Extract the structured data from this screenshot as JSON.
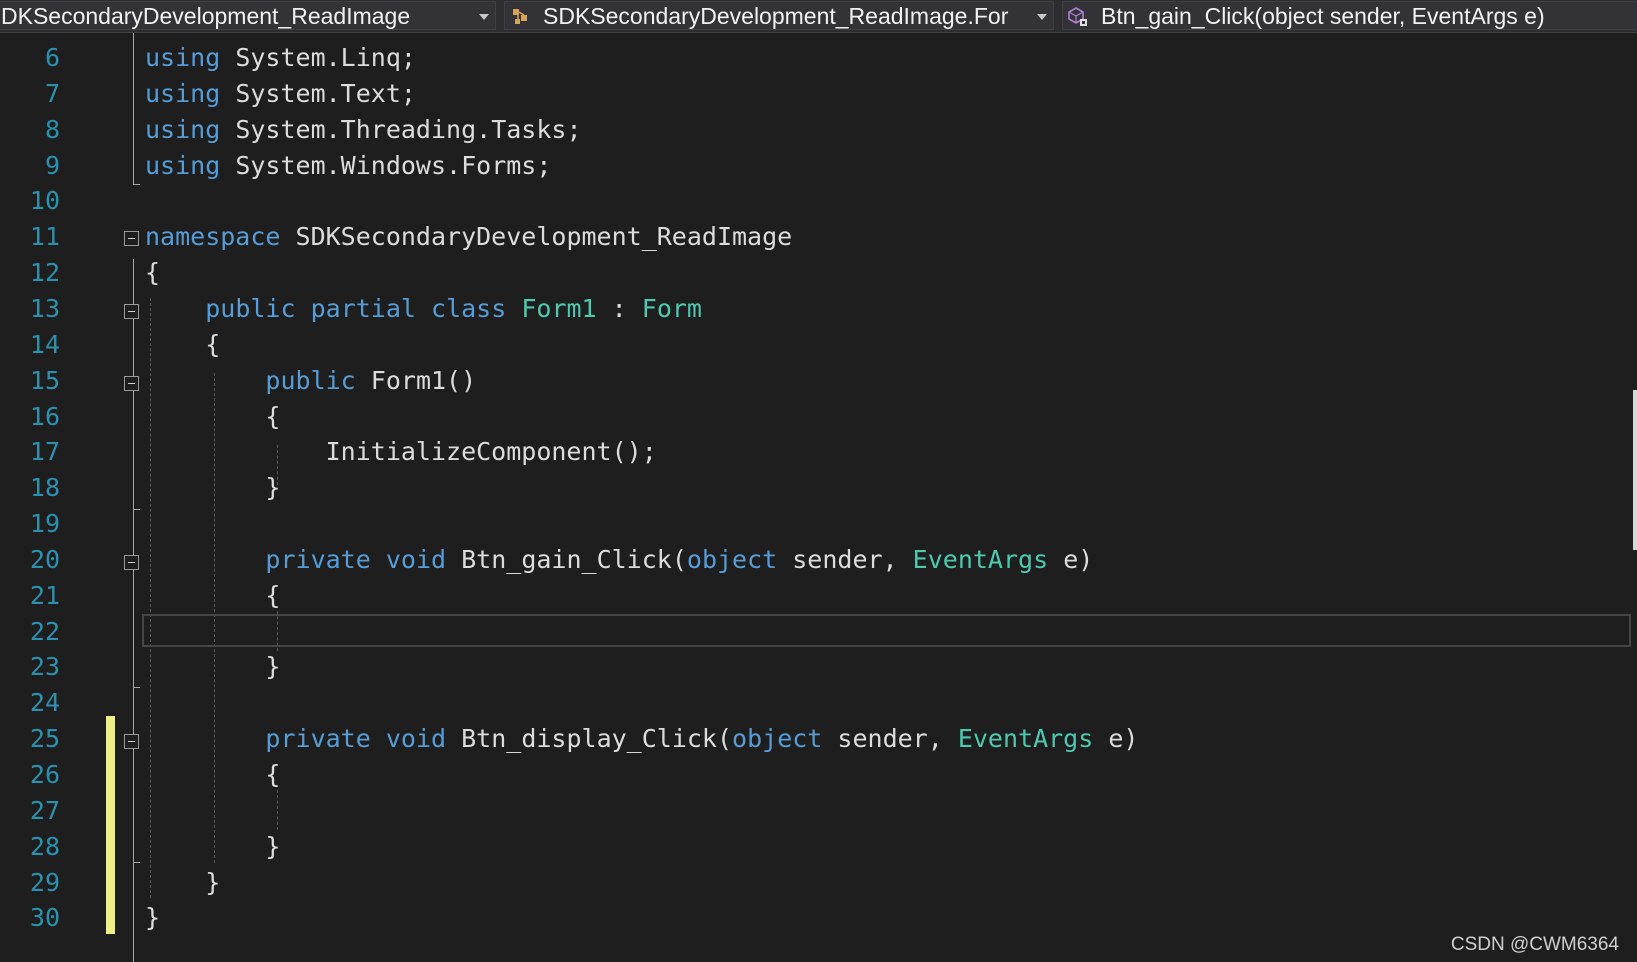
{
  "navigation_bar": {
    "project_dropdown": {
      "label": "DKSecondaryDevelopment_ReadImage"
    },
    "type_dropdown": {
      "label": "SDKSecondaryDevelopment_ReadImage.For"
    },
    "member_dropdown": {
      "label": "Btn_gain_Click(object sender, EventArgs e)"
    }
  },
  "editor": {
    "lines": [
      {
        "number": "6",
        "tokens": [
          [
            "kw",
            "using"
          ],
          [
            "pl",
            " System.Linq;"
          ]
        ]
      },
      {
        "number": "7",
        "tokens": [
          [
            "kw",
            "using"
          ],
          [
            "pl",
            " System.Text;"
          ]
        ]
      },
      {
        "number": "8",
        "tokens": [
          [
            "kw",
            "using"
          ],
          [
            "pl",
            " System.Threading.Tasks;"
          ]
        ]
      },
      {
        "number": "9",
        "tokens": [
          [
            "kw",
            "using"
          ],
          [
            "pl",
            " System.Windows.Forms;"
          ]
        ]
      },
      {
        "number": "10",
        "tokens": []
      },
      {
        "number": "11",
        "tokens": [
          [
            "kw",
            "namespace"
          ],
          [
            "pl",
            " SDKSecondaryDevelopment_ReadImage"
          ]
        ]
      },
      {
        "number": "12",
        "tokens": [
          [
            "pl",
            "{"
          ]
        ]
      },
      {
        "number": "13",
        "tokens": [
          [
            "pl",
            "    "
          ],
          [
            "kw",
            "public"
          ],
          [
            "pl",
            " "
          ],
          [
            "kw",
            "partial"
          ],
          [
            "pl",
            " "
          ],
          [
            "kw",
            "class"
          ],
          [
            "pl",
            " "
          ],
          [
            "ty",
            "Form1"
          ],
          [
            "pl",
            " : "
          ],
          [
            "ty",
            "Form"
          ]
        ]
      },
      {
        "number": "14",
        "tokens": [
          [
            "pl",
            "    {"
          ]
        ]
      },
      {
        "number": "15",
        "tokens": [
          [
            "pl",
            "        "
          ],
          [
            "kw",
            "public"
          ],
          [
            "pl",
            " Form1()"
          ]
        ]
      },
      {
        "number": "16",
        "tokens": [
          [
            "pl",
            "        {"
          ]
        ]
      },
      {
        "number": "17",
        "tokens": [
          [
            "pl",
            "            InitializeComponent();"
          ]
        ]
      },
      {
        "number": "18",
        "tokens": [
          [
            "pl",
            "        }"
          ]
        ]
      },
      {
        "number": "19",
        "tokens": []
      },
      {
        "number": "20",
        "tokens": [
          [
            "pl",
            "        "
          ],
          [
            "kw",
            "private"
          ],
          [
            "pl",
            " "
          ],
          [
            "kw",
            "void"
          ],
          [
            "pl",
            " Btn_gain_Click("
          ],
          [
            "kw",
            "object"
          ],
          [
            "pl",
            " sender, "
          ],
          [
            "ty",
            "EventArgs"
          ],
          [
            "pl",
            " e)"
          ]
        ]
      },
      {
        "number": "21",
        "tokens": [
          [
            "pl",
            "        {"
          ]
        ]
      },
      {
        "number": "22",
        "tokens": []
      },
      {
        "number": "23",
        "tokens": [
          [
            "pl",
            "        }"
          ]
        ]
      },
      {
        "number": "24",
        "tokens": []
      },
      {
        "number": "25",
        "tokens": [
          [
            "pl",
            "        "
          ],
          [
            "kw",
            "private"
          ],
          [
            "pl",
            " "
          ],
          [
            "kw",
            "void"
          ],
          [
            "pl",
            " Btn_display_Click("
          ],
          [
            "kw",
            "object"
          ],
          [
            "pl",
            " sender, "
          ],
          [
            "ty",
            "EventArgs"
          ],
          [
            "pl",
            " e)"
          ]
        ]
      },
      {
        "number": "26",
        "tokens": [
          [
            "pl",
            "        {"
          ]
        ]
      },
      {
        "number": "27",
        "tokens": []
      },
      {
        "number": "28",
        "tokens": [
          [
            "pl",
            "        }"
          ]
        ]
      },
      {
        "number": "29",
        "tokens": [
          [
            "pl",
            "    }"
          ]
        ]
      },
      {
        "number": "30",
        "tokens": [
          [
            "pl",
            "}"
          ]
        ]
      }
    ],
    "collapsible_lines": [
      "11",
      "13",
      "15",
      "20",
      "25"
    ],
    "current_line": "22",
    "changed_lines": [
      "24",
      "25",
      "26",
      "27",
      "28",
      "29"
    ]
  },
  "watermark": "CSDN @CWM6364",
  "colors": {
    "background": "#1e1e1e",
    "line_number": "#2b91af",
    "keyword": "#569cd6",
    "type": "#4ec9b0",
    "plain": "#dcdcdc",
    "change_bar": "#efef87"
  }
}
